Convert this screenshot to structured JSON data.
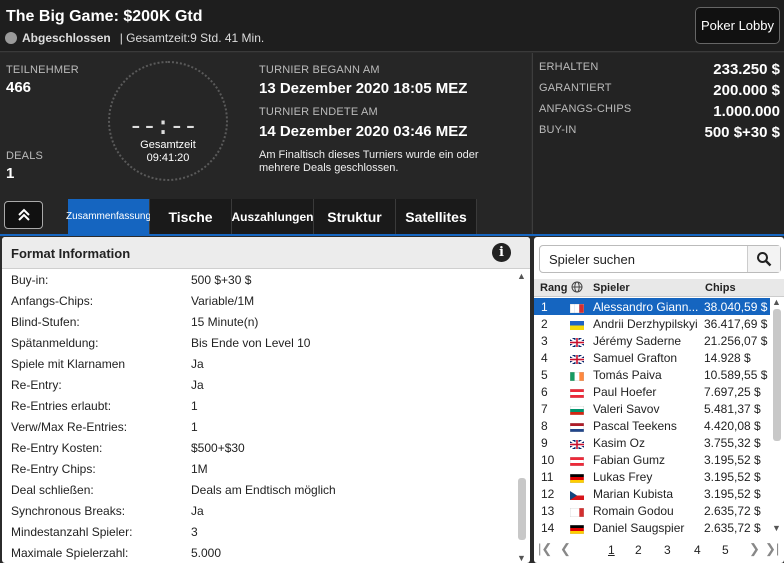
{
  "header": {
    "title": "The Big Game: $200K Gtd",
    "status": "Abgeschlossen",
    "total_time": "| Gesamtzeit:9 Std.  41 Min.",
    "lobby_button": "Poker Lobby"
  },
  "info": {
    "participants_label": "TEILNEHMER",
    "participants": "466",
    "deals_label": "DEALS",
    "deals": "1",
    "clock_label": "Gesamtzeit",
    "clock_time": "09:41:20",
    "clock_digits": "--:--",
    "began_label": "TURNIER BEGANN AM",
    "began": "13 Dezember 2020  18:05 MEZ",
    "ended_label": "TURNIER ENDETE AM",
    "ended": "14 Dezember 2020  03:46 MEZ",
    "note": "Am Finaltisch dieses Turniers wurde ein oder mehrere Deals geschlossen."
  },
  "right_info": [
    {
      "label": "ERHALTEN",
      "value": "233.250 $"
    },
    {
      "label": "GARANTIERT",
      "value": "200.000 $"
    },
    {
      "label": "ANFANGS-CHIPS",
      "value": "1.000.000"
    },
    {
      "label": "BUY-IN",
      "value": "500 $+30 $"
    }
  ],
  "tabs": [
    "Zusammenfassung",
    "Tische",
    "Auszahlungen",
    "Struktur",
    "Satellites"
  ],
  "format": {
    "title": "Format Information",
    "rows": [
      {
        "k": "Buy-in:",
        "v": "500 $+30 $"
      },
      {
        "k": "Anfangs-Chips:",
        "v": "Variable/1M"
      },
      {
        "k": "Blind-Stufen:",
        "v": "15 Minute(n)"
      },
      {
        "k": "Spätanmeldung:",
        "v": "Bis Ende von Level 10"
      },
      {
        "k": "Spiele mit Klarnamen",
        "v": "Ja"
      },
      {
        "k": "Re-Entry:",
        "v": "Ja"
      },
      {
        "k": "Re-Entries erlaubt:",
        "v": "1"
      },
      {
        "k": "Verw/Max Re-Entries:",
        "v": "1"
      },
      {
        "k": "Re-Entry Kosten:",
        "v": "$500+$30"
      },
      {
        "k": "Re-Entry Chips:",
        "v": "1M"
      },
      {
        "k": "Deal schließen:",
        "v": "Deals am Endtisch möglich"
      },
      {
        "k": "Synchronous Breaks:",
        "v": "Ja"
      },
      {
        "k": "Mindestanzahl Spieler:",
        "v": "3"
      },
      {
        "k": "Maximale Spielerzahl:",
        "v": "5.000"
      }
    ]
  },
  "players": {
    "search_placeholder": "Spieler suchen",
    "col_rank": "Rang",
    "col_player": "Spieler",
    "col_chips": "Chips",
    "rows": [
      {
        "r": "1",
        "n": "Alessandro Giann...",
        "c": "38.040,59 $",
        "flag": [
          "#fff",
          "#fff",
          "#d32f2f"
        ]
      },
      {
        "r": "2",
        "n": "Andrii Derzhypilskyi",
        "c": "36.417,69 $",
        "flag": [
          "#1e63c6",
          "#f5d90a"
        ]
      },
      {
        "r": "3",
        "n": "Jérémy Saderne",
        "c": "21.256,07 $",
        "flag": "uk"
      },
      {
        "r": "4",
        "n": "Samuel Grafton",
        "c": "14.928 $",
        "flag": "uk"
      },
      {
        "r": "5",
        "n": "Tomás Paiva",
        "c": "10.589,55 $",
        "flag": [
          "#169b62",
          "#fff",
          "#ff883e"
        ]
      },
      {
        "r": "6",
        "n": "Paul Hoefer",
        "c": "7.697,25 $",
        "flag": [
          "#ed2939",
          "#fff",
          "#ed2939"
        ]
      },
      {
        "r": "7",
        "n": "Valeri Savov",
        "c": "5.481,37 $",
        "flag": [
          "#fff",
          "#00966e",
          "#d62612"
        ]
      },
      {
        "r": "8",
        "n": "Pascal Teekens",
        "c": "4.420,08 $",
        "flag": [
          "#ae1c28",
          "#fff",
          "#21468b"
        ]
      },
      {
        "r": "9",
        "n": "Kasim Oz",
        "c": "3.755,32 $",
        "flag": "uk"
      },
      {
        "r": "10",
        "n": "Fabian Gumz",
        "c": "3.195,52 $",
        "flag": [
          "#ed2939",
          "#fff",
          "#ed2939"
        ]
      },
      {
        "r": "11",
        "n": "Lukas Frey",
        "c": "3.195,52 $",
        "flag": [
          "#000",
          "#dd0000",
          "#ffce00"
        ]
      },
      {
        "r": "12",
        "n": "Marian Kubista",
        "c": "3.195,52 $",
        "flag": "cz"
      },
      {
        "r": "13",
        "n": "Romain Godou",
        "c": "2.635,72 $",
        "flag": [
          "#fff",
          "#fff",
          "#d32f2f"
        ]
      },
      {
        "r": "14",
        "n": "Daniel Saugspier",
        "c": "2.635,72 $",
        "flag": [
          "#000",
          "#dd0000",
          "#ffce00"
        ]
      }
    ],
    "pages": [
      "1",
      "2",
      "3",
      "4",
      "5"
    ]
  }
}
